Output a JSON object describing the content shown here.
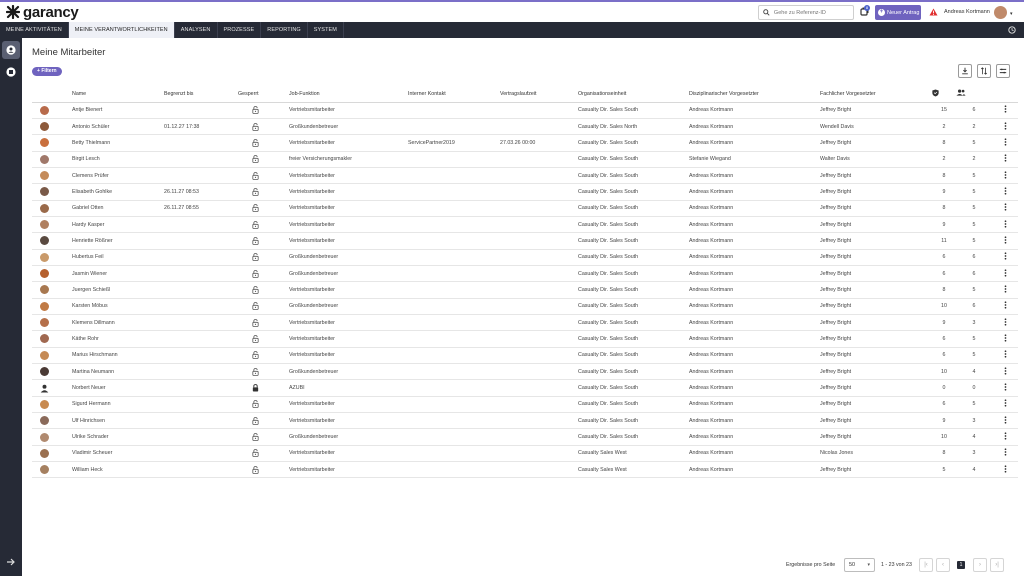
{
  "app": {
    "logo_text": "garancy",
    "search_placeholder": "Gehe zu Referenz-ID",
    "notification_count": "8",
    "new_request_label": "Neuer Antrag",
    "user_name": "Andreas Kortmann"
  },
  "nav": [
    "MEINE AKTIVITÄTEN",
    "MEINE VERANTWORTLICHKEITEN",
    "ANALYSEN",
    "PROZESSE",
    "REPORTING",
    "SYSTEM"
  ],
  "nav_active": 1,
  "page": {
    "title": "Meine Mitarbeiter",
    "filter_label": "Filtern"
  },
  "columns": [
    "Name",
    "Begrenzt bis",
    "Gesperrt",
    "Job-Funktion",
    "Interner Kontakt",
    "Vertragslaufzeit",
    "Organisationseinheit",
    "Disziplinarischer Vorgesetzter",
    "Fachlicher Vorgesetzter"
  ],
  "rows": [
    {
      "name": "Antje Bienert",
      "until": "",
      "job": "Vertriebsmitarbeiter",
      "contact": "",
      "term": "",
      "org": "Casualty Dir. Sales South",
      "disc": "Andreas Kortmann",
      "tech": "Jeffrey Bright",
      "n1": "15",
      "n2": "6",
      "av": "#b86b4b",
      "locked": false
    },
    {
      "name": "Antonio Schüler",
      "until": "01.12.27 17:38",
      "job": "Großkundenbetreuer",
      "contact": "",
      "term": "",
      "org": "Casualty Dir. Sales North",
      "disc": "Andreas Kortmann",
      "tech": "Wendell Davis",
      "n1": "2",
      "n2": "2",
      "av": "#8d5a3b",
      "locked": false
    },
    {
      "name": "Betty Thielmann",
      "until": "",
      "job": "Vertriebsmitarbeiter",
      "contact": "ServicePartner2019",
      "term": "27.03.26 00:00",
      "org": "Casualty Dir. Sales South",
      "disc": "Andreas Kortmann",
      "tech": "Jeffrey Bright",
      "n1": "8",
      "n2": "5",
      "av": "#c9703e",
      "locked": false
    },
    {
      "name": "Birgit Lesch",
      "until": "",
      "job": "freier Versicherungsmakler",
      "contact": "",
      "term": "",
      "org": "Casualty Dir. Sales South",
      "disc": "Stefanie Wiegand",
      "tech": "Walter Davis",
      "n1": "2",
      "n2": "2",
      "av": "#a0786a",
      "locked": false
    },
    {
      "name": "Clemens Prüfer",
      "until": "",
      "job": "Vertriebsmitarbeiter",
      "contact": "",
      "term": "",
      "org": "Casualty Dir. Sales South",
      "disc": "Andreas Kortmann",
      "tech": "Jeffrey Bright",
      "n1": "8",
      "n2": "5",
      "av": "#c48b5a",
      "locked": false
    },
    {
      "name": "Elisabeth Gohlke",
      "until": "26.11.27 08:53",
      "job": "Vertriebsmitarbeiter",
      "contact": "",
      "term": "",
      "org": "Casualty Dir. Sales South",
      "disc": "Andreas Kortmann",
      "tech": "Jeffrey Bright",
      "n1": "9",
      "n2": "5",
      "av": "#7a5a48",
      "locked": false
    },
    {
      "name": "Gabriel Otten",
      "until": "26.11.27 08:55",
      "job": "Vertriebsmitarbeiter",
      "contact": "",
      "term": "",
      "org": "Casualty Dir. Sales South",
      "disc": "Andreas Kortmann",
      "tech": "Jeffrey Bright",
      "n1": "8",
      "n2": "5",
      "av": "#9a6a4a",
      "locked": false
    },
    {
      "name": "Hardy Kasper",
      "until": "",
      "job": "Vertriebsmitarbeiter",
      "contact": "",
      "term": "",
      "org": "Casualty Dir. Sales South",
      "disc": "Andreas Kortmann",
      "tech": "Jeffrey Bright",
      "n1": "9",
      "n2": "5",
      "av": "#b08060",
      "locked": false
    },
    {
      "name": "Henriette Rößner",
      "until": "",
      "job": "Vertriebsmitarbeiter",
      "contact": "",
      "term": "",
      "org": "Casualty Dir. Sales South",
      "disc": "Andreas Kortmann",
      "tech": "Jeffrey Bright",
      "n1": "11",
      "n2": "5",
      "av": "#5a4a40",
      "locked": false
    },
    {
      "name": "Hubertus Feil",
      "until": "",
      "job": "Großkundenbetreuer",
      "contact": "",
      "term": "",
      "org": "Casualty Dir. Sales South",
      "disc": "Andreas Kortmann",
      "tech": "Jeffrey Bright",
      "n1": "6",
      "n2": "6",
      "av": "#c99a6a",
      "locked": false
    },
    {
      "name": "Jasmin Wiener",
      "until": "",
      "job": "Großkundenbetreuer",
      "contact": "",
      "term": "",
      "org": "Casualty Dir. Sales South",
      "disc": "Andreas Kortmann",
      "tech": "Jeffrey Bright",
      "n1": "6",
      "n2": "6",
      "av": "#b5602e",
      "locked": false
    },
    {
      "name": "Juergen Schießl",
      "until": "",
      "job": "Vertriebsmitarbeiter",
      "contact": "",
      "term": "",
      "org": "Casualty Dir. Sales South",
      "disc": "Andreas Kortmann",
      "tech": "Jeffrey Bright",
      "n1": "8",
      "n2": "5",
      "av": "#a87850",
      "locked": false
    },
    {
      "name": "Karsten Möbus",
      "until": "",
      "job": "Großkundenbetreuer",
      "contact": "",
      "term": "",
      "org": "Casualty Dir. Sales South",
      "disc": "Andreas Kortmann",
      "tech": "Jeffrey Bright",
      "n1": "10",
      "n2": "6",
      "av": "#c07a45",
      "locked": false
    },
    {
      "name": "Klemens Dillmann",
      "until": "",
      "job": "Vertriebsmitarbeiter",
      "contact": "",
      "term": "",
      "org": "Casualty Dir. Sales South",
      "disc": "Andreas Kortmann",
      "tech": "Jeffrey Bright",
      "n1": "9",
      "n2": "3",
      "av": "#b5704a",
      "locked": false
    },
    {
      "name": "Käthe Rohr",
      "until": "",
      "job": "Vertriebsmitarbeiter",
      "contact": "",
      "term": "",
      "org": "Casualty Dir. Sales South",
      "disc": "Andreas Kortmann",
      "tech": "Jeffrey Bright",
      "n1": "6",
      "n2": "5",
      "av": "#a06850",
      "locked": false
    },
    {
      "name": "Marius Hirschmann",
      "until": "",
      "job": "Vertriebsmitarbeiter",
      "contact": "",
      "term": "",
      "org": "Casualty Dir. Sales South",
      "disc": "Andreas Kortmann",
      "tech": "Jeffrey Bright",
      "n1": "6",
      "n2": "5",
      "av": "#c58a55",
      "locked": false
    },
    {
      "name": "Martina Neumann",
      "until": "",
      "job": "Großkundenbetreuer",
      "contact": "",
      "term": "",
      "org": "Casualty Dir. Sales South",
      "disc": "Andreas Kortmann",
      "tech": "Jeffrey Bright",
      "n1": "10",
      "n2": "4",
      "av": "#4a3a35",
      "locked": false
    },
    {
      "name": "Norbert Neuer",
      "until": "",
      "job": "AZUBI",
      "contact": "",
      "term": "",
      "org": "Casualty Dir. Sales South",
      "disc": "Andreas Kortmann",
      "tech": "Jeffrey Bright",
      "n1": "0",
      "n2": "0",
      "av": "",
      "locked": true
    },
    {
      "name": "Sigurd Hermann",
      "until": "",
      "job": "Vertriebsmitarbeiter",
      "contact": "",
      "term": "",
      "org": "Casualty Dir. Sales South",
      "disc": "Andreas Kortmann",
      "tech": "Jeffrey Bright",
      "n1": "6",
      "n2": "5",
      "av": "#c88a50",
      "locked": false
    },
    {
      "name": "Ulf Hinrichsen",
      "until": "",
      "job": "Vertriebsmitarbeiter",
      "contact": "",
      "term": "",
      "org": "Casualty Dir. Sales South",
      "disc": "Andreas Kortmann",
      "tech": "Jeffrey Bright",
      "n1": "9",
      "n2": "3",
      "av": "#8a6a5a",
      "locked": false
    },
    {
      "name": "Ulrike Schrader",
      "until": "",
      "job": "Großkundenbetreuer",
      "contact": "",
      "term": "",
      "org": "Casualty Dir. Sales South",
      "disc": "Andreas Kortmann",
      "tech": "Jeffrey Bright",
      "n1": "10",
      "n2": "4",
      "av": "#b08a70",
      "locked": false
    },
    {
      "name": "Vladimir Scheuer",
      "until": "",
      "job": "Vertriebsmitarbeiter",
      "contact": "",
      "term": "",
      "org": "Casualty Sales West",
      "disc": "Andreas Kortmann",
      "tech": "Nicolas Jones",
      "n1": "8",
      "n2": "3",
      "av": "#9a7050",
      "locked": false
    },
    {
      "name": "William Heck",
      "until": "",
      "job": "Vertriebsmitarbeiter",
      "contact": "",
      "term": "",
      "org": "Casualty Sales West",
      "disc": "Andreas Kortmann",
      "tech": "Jeffrey Bright",
      "n1": "5",
      "n2": "4",
      "av": "#a58060",
      "locked": false
    }
  ],
  "pagination": {
    "label": "Ergebnisse pro Seite",
    "per_page": "50",
    "range": "1 - 23 von 23",
    "current_page": "1"
  },
  "colors": {
    "nav_bg": "#262a36",
    "accent": "#6f63bf"
  }
}
